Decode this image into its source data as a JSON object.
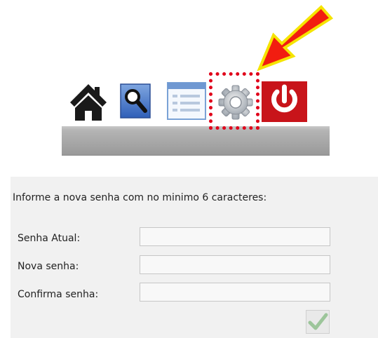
{
  "toolbar": {
    "icons": [
      "home-icon",
      "search-icon",
      "list-icon",
      "gear-icon",
      "power-icon"
    ],
    "highlight_color": "#e0001a",
    "arrow_color": "#f21d10",
    "arrow_outline": "#f5e400"
  },
  "form": {
    "instructions": "Informe a nova senha com no minimo 6 caracteres:",
    "fields": [
      {
        "label": "Senha Atual:",
        "value": "",
        "placeholder": ""
      },
      {
        "label": "Nova senha:",
        "value": "",
        "placeholder": ""
      },
      {
        "label": "Confirma senha:",
        "value": "",
        "placeholder": ""
      }
    ],
    "submit_icon": "checkmark-icon",
    "panel_color": "#f1f1f1"
  }
}
